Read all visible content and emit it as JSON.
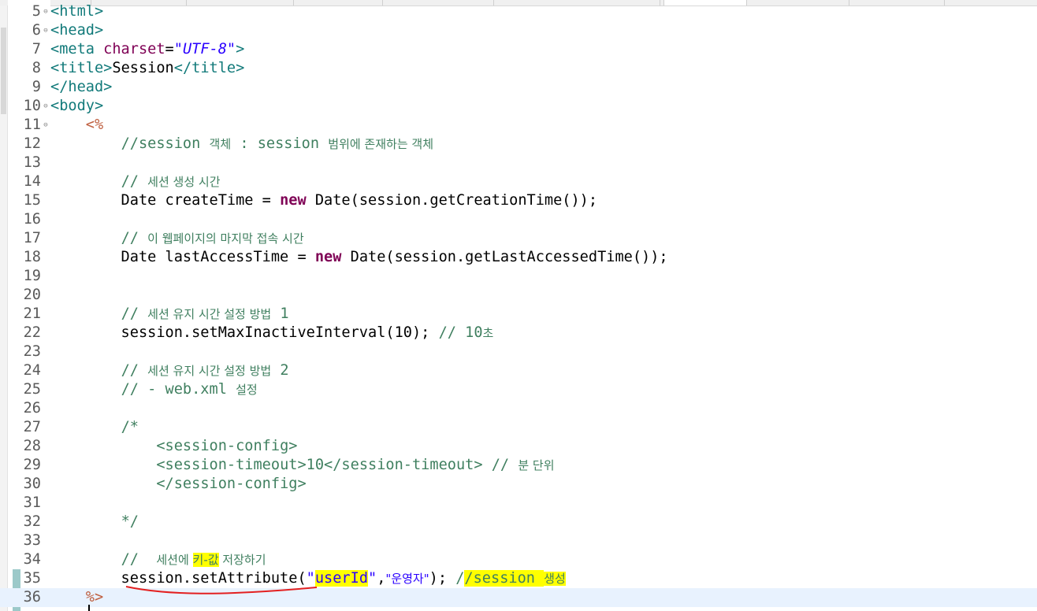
{
  "editor": {
    "lines": [
      {
        "n": "5",
        "fold": "⊖",
        "tokens": [
          [
            "tag",
            "<html>"
          ]
        ]
      },
      {
        "n": "6",
        "fold": "⊖",
        "tokens": [
          [
            "tag",
            "<head>"
          ]
        ]
      },
      {
        "n": "7",
        "fold": "",
        "tokens": [
          [
            "tag",
            "<meta "
          ],
          [
            "attr",
            "charset"
          ],
          [
            "plain",
            "="
          ],
          [
            "str",
            "\"UTF-8\""
          ],
          [
            "tag",
            ">"
          ]
        ]
      },
      {
        "n": "8",
        "fold": "",
        "tokens": [
          [
            "tag",
            "<title>"
          ],
          [
            "plain",
            "Session"
          ],
          [
            "tag",
            "</title>"
          ]
        ]
      },
      {
        "n": "9",
        "fold": "",
        "tokens": [
          [
            "tag",
            "</head>"
          ]
        ]
      },
      {
        "n": "10",
        "fold": "⊖",
        "tokens": [
          [
            "tag",
            "<body>"
          ]
        ]
      },
      {
        "n": "11",
        "fold": "⊖",
        "tokens": [
          [
            "plain",
            "    "
          ],
          [
            "delim",
            "<%"
          ]
        ]
      },
      {
        "n": "12",
        "fold": "",
        "tokens": [
          [
            "plain",
            "        "
          ],
          [
            "cmt",
            "//session "
          ],
          [
            "cmt kor",
            "객체"
          ],
          [
            "cmt",
            " : session "
          ],
          [
            "cmt kor",
            "범위에 존재하는 객체"
          ]
        ]
      },
      {
        "n": "13",
        "fold": "",
        "tokens": []
      },
      {
        "n": "14",
        "fold": "",
        "tokens": [
          [
            "plain",
            "        "
          ],
          [
            "cmt",
            "// "
          ],
          [
            "cmt kor",
            "세션 생성 시간"
          ]
        ]
      },
      {
        "n": "15",
        "fold": "",
        "tokens": [
          [
            "plain",
            "        Date createTime = "
          ],
          [
            "kw",
            "new"
          ],
          [
            "plain",
            " Date(session.getCreationTime());"
          ]
        ]
      },
      {
        "n": "16",
        "fold": "",
        "tokens": []
      },
      {
        "n": "17",
        "fold": "",
        "tokens": [
          [
            "plain",
            "        "
          ],
          [
            "cmt",
            "// "
          ],
          [
            "cmt kor",
            "이 웹페이지의 마지막 접속 시간"
          ]
        ]
      },
      {
        "n": "18",
        "fold": "",
        "tokens": [
          [
            "plain",
            "        Date lastAccessTime = "
          ],
          [
            "kw",
            "new"
          ],
          [
            "plain",
            " Date(session.getLastAccessedTime());"
          ]
        ]
      },
      {
        "n": "19",
        "fold": "",
        "tokens": []
      },
      {
        "n": "20",
        "fold": "",
        "tokens": []
      },
      {
        "n": "21",
        "fold": "",
        "tokens": [
          [
            "plain",
            "        "
          ],
          [
            "cmt",
            "// "
          ],
          [
            "cmt kor",
            "세션 유지 시간 설정 방법"
          ],
          [
            "cmt",
            " 1"
          ]
        ]
      },
      {
        "n": "22",
        "fold": "",
        "tokens": [
          [
            "plain",
            "        session.setMaxInactiveInterval(10); "
          ],
          [
            "cmt",
            "// 10"
          ],
          [
            "cmt kor",
            "초"
          ]
        ]
      },
      {
        "n": "23",
        "fold": "",
        "tokens": []
      },
      {
        "n": "24",
        "fold": "",
        "tokens": [
          [
            "plain",
            "        "
          ],
          [
            "cmt",
            "// "
          ],
          [
            "cmt kor",
            "세션 유지 시간 설정 방법"
          ],
          [
            "cmt",
            " 2"
          ]
        ]
      },
      {
        "n": "25",
        "fold": "",
        "tokens": [
          [
            "plain",
            "        "
          ],
          [
            "cmt",
            "// - web.xml "
          ],
          [
            "cmt kor",
            "설정"
          ]
        ]
      },
      {
        "n": "26",
        "fold": "",
        "tokens": []
      },
      {
        "n": "27",
        "fold": "",
        "tokens": [
          [
            "plain",
            "        "
          ],
          [
            "cmt",
            "/*"
          ]
        ]
      },
      {
        "n": "28",
        "fold": "",
        "tokens": [
          [
            "plain",
            "            "
          ],
          [
            "cmt",
            "<session-config>"
          ]
        ]
      },
      {
        "n": "29",
        "fold": "",
        "tokens": [
          [
            "plain",
            "            "
          ],
          [
            "cmt",
            "<session-timeout>10</session-timeout> // "
          ],
          [
            "cmt kor",
            "분 단위"
          ]
        ]
      },
      {
        "n": "30",
        "fold": "",
        "tokens": [
          [
            "plain",
            "            "
          ],
          [
            "cmt",
            "</session-config>"
          ]
        ]
      },
      {
        "n": "31",
        "fold": "",
        "tokens": []
      },
      {
        "n": "32",
        "fold": "",
        "tokens": [
          [
            "plain",
            "        "
          ],
          [
            "cmt",
            "*/"
          ]
        ]
      },
      {
        "n": "33",
        "fold": "",
        "tokens": []
      },
      {
        "n": "34",
        "fold": "",
        "tokens": [
          [
            "plain",
            "        "
          ],
          [
            "cmt",
            "//  "
          ],
          [
            "cmt kor",
            "세션에 "
          ],
          [
            "cmt kor hl",
            "키-값"
          ],
          [
            "cmt kor",
            " 저장하기"
          ]
        ]
      },
      {
        "n": "35",
        "fold": "",
        "tokens": [
          [
            "plain",
            "        session.setAttribute("
          ],
          [
            "jstr",
            "\""
          ],
          [
            "jstr hl",
            "userId"
          ],
          [
            "jstr",
            "\""
          ],
          [
            "plain",
            ","
          ],
          [
            "jstr kor",
            "\"운영자\""
          ],
          [
            "plain",
            "); "
          ],
          [
            "cmt",
            "/"
          ],
          [
            "cmt hl",
            "/session "
          ],
          [
            "cmt kor hl",
            "생성"
          ]
        ]
      },
      {
        "n": "36",
        "fold": "",
        "tokens": [
          [
            "plain",
            "    "
          ],
          [
            "delim",
            "%>"
          ]
        ]
      }
    ]
  }
}
